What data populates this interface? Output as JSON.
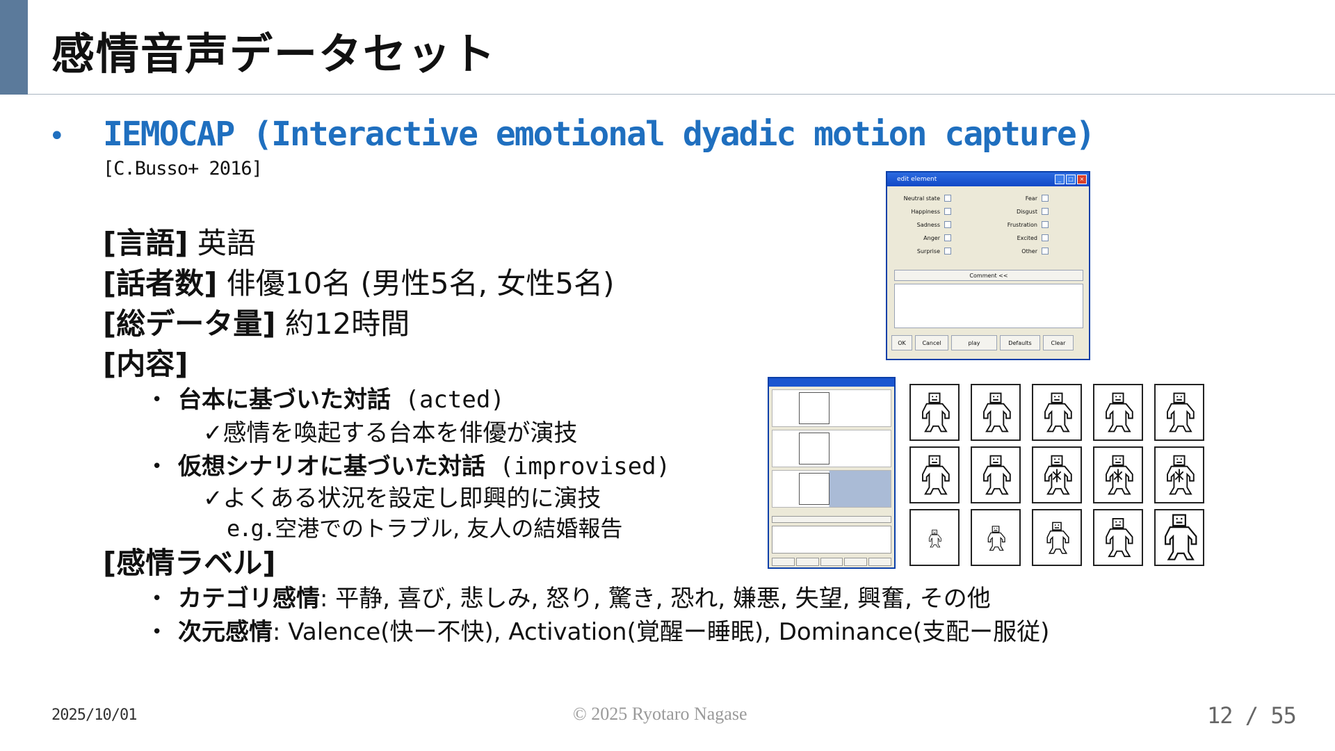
{
  "slide": {
    "title": "感情音声データセット",
    "main_bullet_symbol": "•",
    "main_bullet": "IEMOCAP (Interactive emotional dyadic motion capture)",
    "citation": "[C.Busso+ 2016]",
    "language_label": "[言語]",
    "language_value": " 英語",
    "speakers_label": "[話者数]",
    "speakers_value": " 俳優10名 (男性5名, 女性5名)",
    "total_label": "[総データ量]",
    "total_value": " 約12時間",
    "content_label": "[内容]",
    "acted_bold": "台本に基づいた対話",
    "acted_suffix": " (acted)",
    "acted_detail": "✓感情を喚起する台本を俳優が演技",
    "improv_bold": "仮想シナリオに基づいた対話",
    "improv_suffix": " (improvised)",
    "improv_detail": "✓よくある状況を設定し即興的に演技",
    "example_prefix": "e.g.",
    "example_text": "空港でのトラブル, 友人の結婚報告",
    "emotion_label": "[感情ラベル]",
    "categorical_bold": "カテゴリ感情",
    "categorical_text": ": 平静, 喜び, 悲しみ, 怒り, 驚き, 恐れ, 嫌悪, 失望, 興奮, その他",
    "dimensional_bold": "次元感情",
    "dimensional_text": ": Valence(快ー不快), Activation(覚醒ー睡眠), Dominance(支配ー服従)",
    "sub_bullet_symbol": "•"
  },
  "dialog": {
    "title": "edit element",
    "left_labels": [
      "Neutral state",
      "Happiness",
      "Sadness",
      "Anger",
      "Surprise"
    ],
    "right_labels": [
      "Fear",
      "Disgust",
      "Frustration",
      "Excited",
      "Other"
    ],
    "comment_button": "Comment <<",
    "buttons": [
      "OK",
      "Cancel",
      "play",
      "Defaults",
      "Clear"
    ]
  },
  "footer": {
    "date": "2025/10/01",
    "copyright": "© 2025 Ryotaro Nagase",
    "page": "12 / 55"
  },
  "colors": {
    "accent_bar": "#5b7a9b",
    "heading_blue": "#1f6fbf"
  }
}
